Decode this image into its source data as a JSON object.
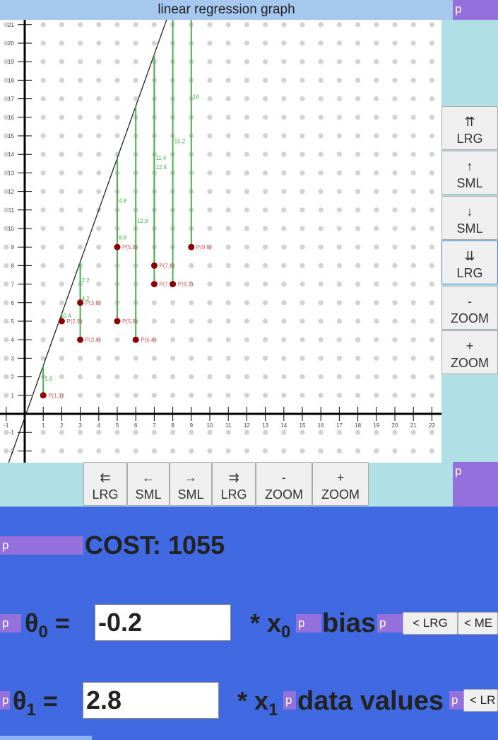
{
  "title": "linear regression graph",
  "p_marker": "p",
  "vertical_controls": [
    {
      "arrow": "⇈",
      "label": "LRG",
      "name": "up-large-button",
      "icon": "double-up-arrow-icon"
    },
    {
      "arrow": "↑",
      "label": "SML",
      "name": "up-small-button",
      "icon": "up-arrow-icon"
    },
    {
      "arrow": "↓",
      "label": "SML",
      "name": "down-small-button",
      "icon": "down-arrow-icon"
    },
    {
      "arrow": "⇊",
      "label": "LRG",
      "name": "down-large-button",
      "icon": "double-down-arrow-icon"
    },
    {
      "arrow": "-",
      "label": "ZOOM",
      "name": "zoom-out-vertical-button",
      "icon": "minus-icon"
    },
    {
      "arrow": "+",
      "label": "ZOOM",
      "name": "zoom-in-vertical-button",
      "icon": "plus-icon"
    }
  ],
  "horizontal_controls": [
    {
      "arrow": "⇇",
      "label": "LRG",
      "name": "left-large-button",
      "icon": "double-left-arrow-icon"
    },
    {
      "arrow": "←",
      "label": "SML",
      "name": "left-small-button",
      "icon": "left-arrow-icon"
    },
    {
      "arrow": "→",
      "label": "SML",
      "name": "right-small-button",
      "icon": "right-arrow-icon"
    },
    {
      "arrow": "⇉",
      "label": "LRG",
      "name": "right-large-button",
      "icon": "double-right-arrow-icon"
    },
    {
      "arrow": "-",
      "label": "ZOOM",
      "name": "zoom-out-horizontal-button",
      "icon": "minus-icon"
    },
    {
      "arrow": "+",
      "label": "ZOOM",
      "name": "zoom-in-horizontal-button",
      "icon": "plus-icon"
    }
  ],
  "cost": {
    "label": "COST: 1055"
  },
  "theta0": {
    "symbol": "θ",
    "sub": "0",
    "equals": "=",
    "value": "-0.2",
    "times": "* x",
    "x_sub": "0",
    "word": "bias",
    "btn1": "< LRG",
    "btn2": "< ME"
  },
  "theta1": {
    "symbol": "θ",
    "sub": "1",
    "equals": "=",
    "value": "2.8",
    "times": "* x",
    "x_sub": "1",
    "word": "data values",
    "btn1": "< LR"
  },
  "colors": {
    "point": "#8b0000",
    "point_label": "#d06060",
    "residual": "#4caf50",
    "line": "#222222",
    "grid_dot": "#d3d3d3"
  },
  "chart_data": {
    "type": "scatter",
    "title": "linear regression graph",
    "xlim": [
      -1,
      22
    ],
    "ylim": [
      -2,
      21
    ],
    "x_ticks": [
      -1,
      1,
      2,
      3,
      4,
      5,
      6,
      7,
      8,
      9,
      10,
      11,
      12,
      13,
      14,
      15,
      16,
      17,
      18,
      19,
      20,
      21,
      22
    ],
    "y_ticks": [
      -2,
      -1,
      1,
      2,
      3,
      4,
      5,
      6,
      7,
      8,
      9,
      10,
      11,
      12,
      13,
      14,
      15,
      16,
      17,
      18,
      19,
      20,
      21
    ],
    "points": [
      {
        "x": 1,
        "y": 1,
        "label": "P(1,1)"
      },
      {
        "x": 2,
        "y": 5,
        "label": "P(2,5)"
      },
      {
        "x": 3,
        "y": 4,
        "label": "P(3,4)"
      },
      {
        "x": 3,
        "y": 6,
        "label": "P(3,6)"
      },
      {
        "x": 5,
        "y": 5,
        "label": "P(5,5)"
      },
      {
        "x": 5,
        "y": 9,
        "label": "P(5,9)"
      },
      {
        "x": 6,
        "y": 4,
        "label": "P(6,4)"
      },
      {
        "x": 7,
        "y": 7,
        "label": "P(7,7)"
      },
      {
        "x": 7,
        "y": 8,
        "label": "P(7,8)"
      },
      {
        "x": 8,
        "y": 7,
        "label": "P(8,7)"
      },
      {
        "x": 9,
        "y": 9,
        "label": "P(9,9)"
      }
    ],
    "residuals": [
      {
        "x": 1,
        "y1": 1,
        "y2": 2.6,
        "label": "1.6"
      },
      {
        "x": 2,
        "y1": 5,
        "y2": 5.4,
        "label": "0.4"
      },
      {
        "x": 3,
        "y1": 6,
        "y2": 8.2,
        "label": "2.2"
      },
      {
        "x": 3,
        "y1": 4,
        "y2": 8.2,
        "label": "4.2"
      },
      {
        "x": 5,
        "y1": 9,
        "y2": 13.8,
        "label": "4.8"
      },
      {
        "x": 5,
        "y1": 5,
        "y2": 13.8,
        "label": "8.8"
      },
      {
        "x": 6,
        "y1": 4,
        "y2": 16.6,
        "label": "12.6"
      },
      {
        "x": 7,
        "y1": 8,
        "y2": 19.4,
        "label": "11.4"
      },
      {
        "x": 7,
        "y1": 7,
        "y2": 19.4,
        "label": "12.4"
      },
      {
        "x": 8,
        "y1": 7,
        "y2": 22.2,
        "label": "15.2"
      },
      {
        "x": 9,
        "y1": 9,
        "y2": 25,
        "label": "16"
      }
    ],
    "line": {
      "theta0": -0.2,
      "theta1": 2.8
    },
    "grid": true
  }
}
